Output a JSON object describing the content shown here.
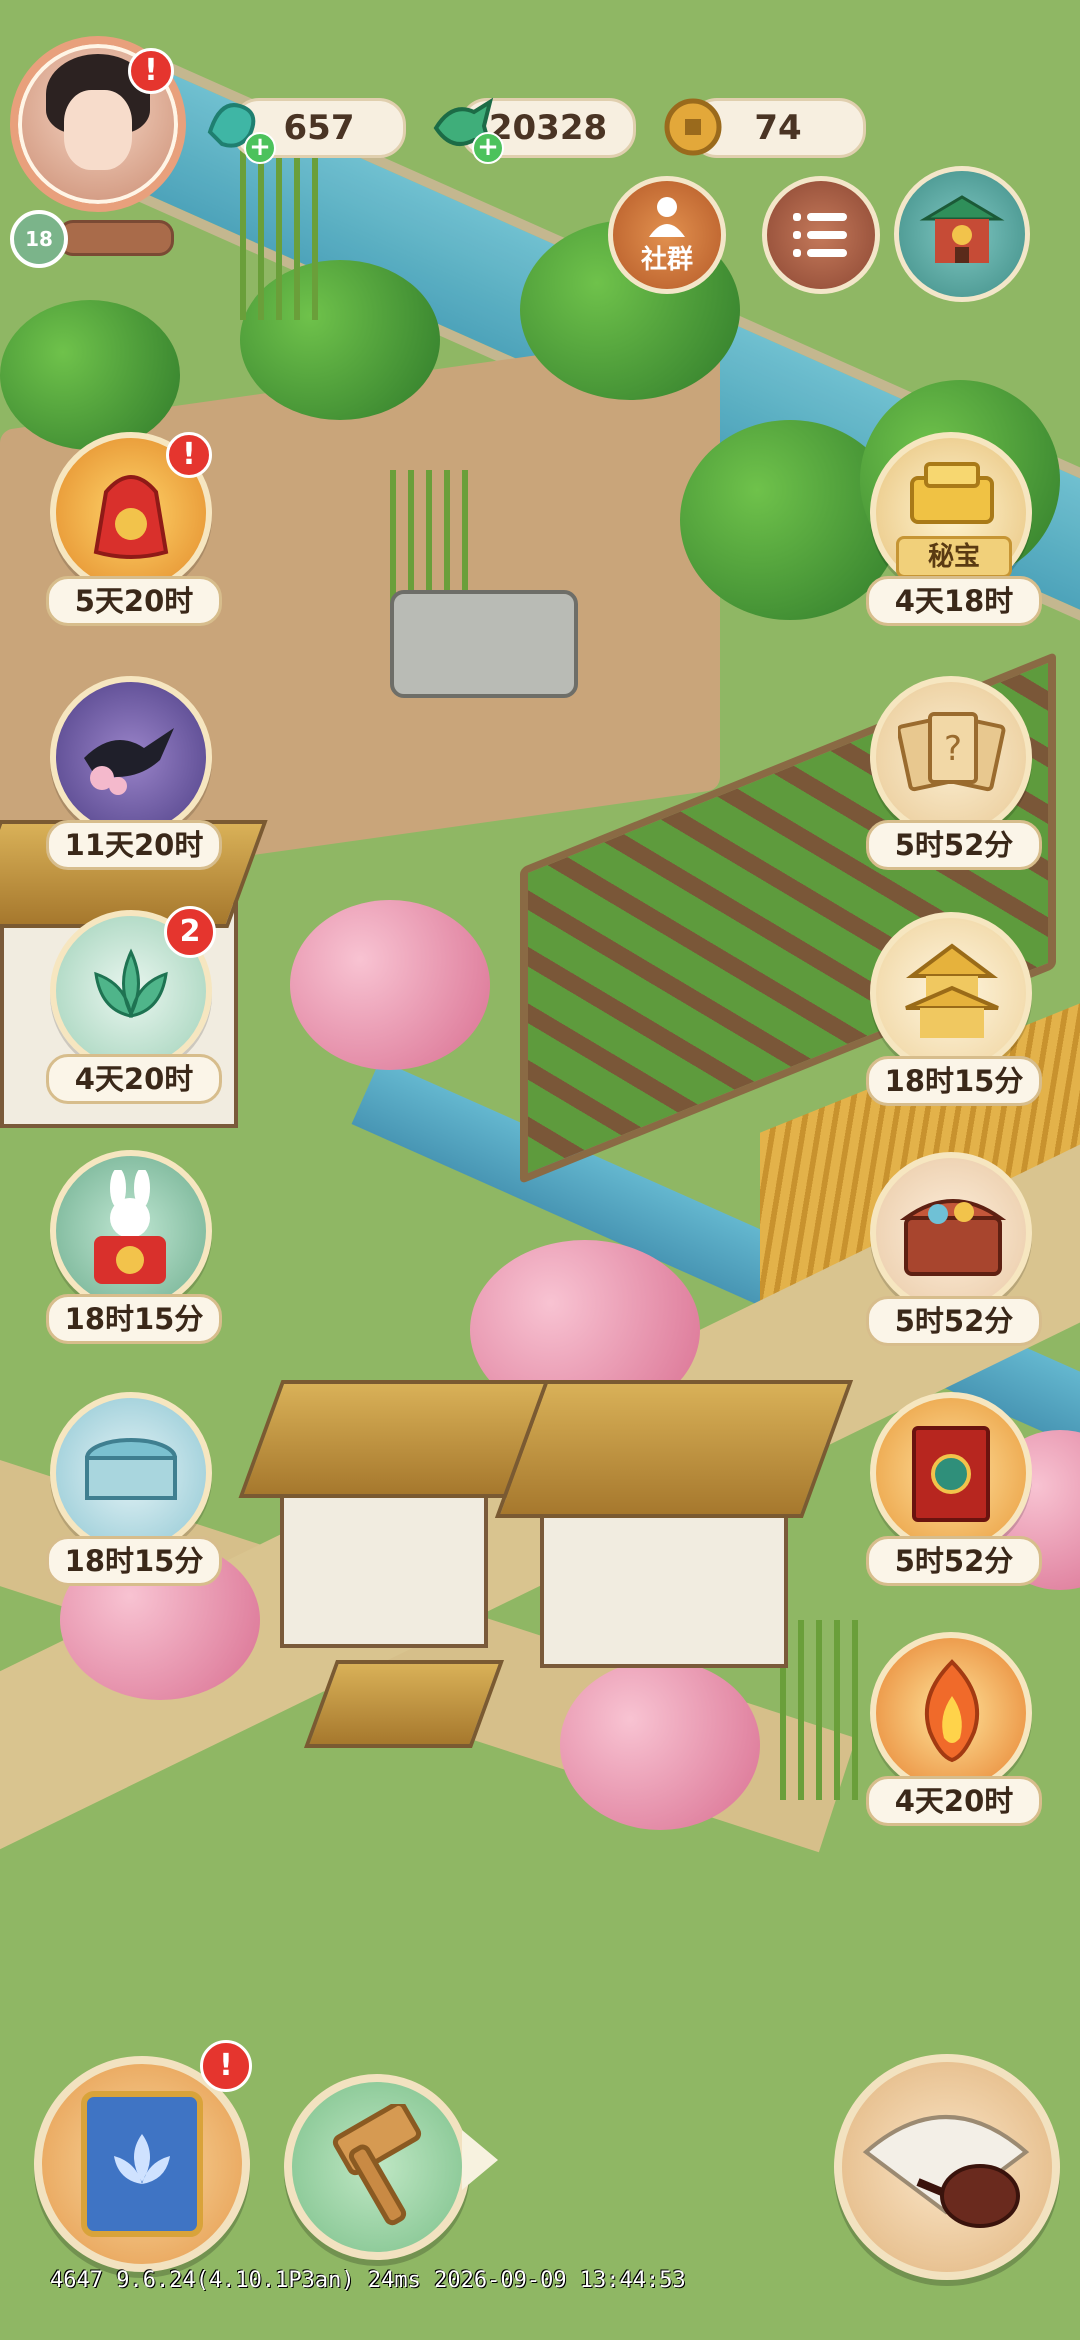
{
  "hud": {
    "player_level": "18",
    "resources": [
      {
        "icon": "jade-dragon-gem-icon",
        "value": "657"
      },
      {
        "icon": "green-carp-token-icon",
        "value": "20328"
      },
      {
        "icon": "copper-coin-icon",
        "value": "74"
      }
    ],
    "community_label": "社群",
    "menu_icon": "list-menu-icon",
    "shop_icon": "pavilion-shop-icon"
  },
  "events_left": [
    {
      "icon": "red-lucky-bag-icon",
      "timer": "5天20时",
      "alert": true
    },
    {
      "icon": "magpie-blossom-icon",
      "timer": "11天20时"
    },
    {
      "icon": "jade-lotus-icon",
      "timer": "4天20时",
      "badge": "2"
    },
    {
      "icon": "rabbit-gift-icon",
      "timer": "18时15分"
    },
    {
      "icon": "moon-well-icon",
      "timer": "18时15分"
    }
  ],
  "events_right": [
    {
      "icon": "gold-treasure-icon",
      "label": "秘宝",
      "timer": "4天18时"
    },
    {
      "icon": "mystery-cards-icon",
      "timer": "5时52分"
    },
    {
      "icon": "golden-pagoda-icon",
      "timer": "18时15分"
    },
    {
      "icon": "treasure-chest-icon",
      "timer": "5时52分"
    },
    {
      "icon": "red-gift-box-icon",
      "timer": "5时52分"
    },
    {
      "icon": "phoenix-flame-icon",
      "timer": "4天20时"
    }
  ],
  "bottom": {
    "book_icon": "lotus-book-icon",
    "hammer_icon": "wooden-hammer-icon",
    "fan_icon": "fan-teapot-icon"
  },
  "debug_text": "4647 9.6.24(4.10.1P3an) 24ms 2026-09-09 13:44:53"
}
